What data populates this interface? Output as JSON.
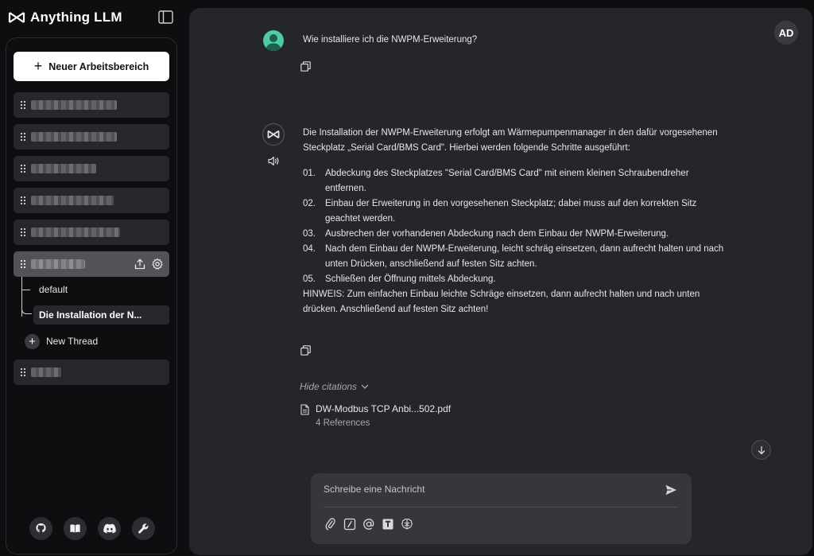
{
  "app": {
    "name": "Anything LLM"
  },
  "sidebar": {
    "new_workspace_label": "Neuer Arbeitsbereich",
    "threads": [
      {
        "label": "default"
      },
      {
        "label": "Die Installation der N..."
      }
    ],
    "new_thread_label": "New Thread"
  },
  "header": {
    "user_initials": "AD"
  },
  "chat": {
    "user_message": "Wie installiere ich die NWPM-Erweiterung?",
    "assistant": {
      "intro": "Die Installation der NWPM-Erweiterung erfolgt am Wärmepumpenmanager in den dafür vorgesehenen Steckplatz „Serial Card/BMS Card\". Hierbei werden folgende Schritte ausgeführt:",
      "steps": [
        {
          "num": "01.",
          "text": "Abdeckung des Steckplatzes \"Serial Card/BMS Card\" mit einem kleinen Schraubendreher entfernen."
        },
        {
          "num": "02.",
          "text": "Einbau der Erweiterung in den vorgesehenen Steckplatz; dabei muss auf den korrekten Sitz geachtet werden."
        },
        {
          "num": "03.",
          "text": "Ausbrechen der vorhandenen Abdeckung nach dem Einbau der NWPM-Erweiterung."
        },
        {
          "num": "04.",
          "text": "Nach dem Einbau der NWPM-Erweiterung, leicht schräg einsetzen, dann aufrecht halten und nach unten Drücken, anschließend auf festen Sitz achten."
        },
        {
          "num": "05.",
          "text": "Schließen der Öffnung mittels Abdeckung."
        }
      ],
      "note": "HINWEIS: Zum einfachen Einbau leichte Schräge einsetzen, dann aufrecht halten und nach unten drücken. Anschließend auf festen Sitz achten!"
    },
    "citations": {
      "toggle_label": "Hide citations",
      "items": [
        {
          "file": "DW-Modbus TCP Anbi...502.pdf",
          "refs": "4 References"
        }
      ]
    }
  },
  "composer": {
    "placeholder": "Schreibe eine Nachricht"
  },
  "colors": {
    "accent": "#4ecba8",
    "main_bg": "#25262a",
    "sidebar_bg": "#0e0e10"
  }
}
